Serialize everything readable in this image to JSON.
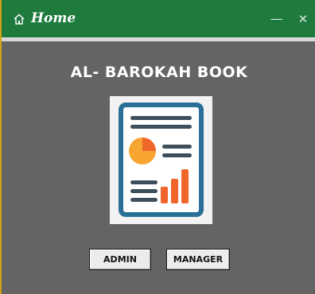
{
  "window": {
    "title": "Home",
    "minimize_symbol": "—",
    "close_symbol": "✕",
    "title_icon": "home-icon"
  },
  "main": {
    "app_title": "AL- BAROKAH BOOK",
    "image_icon": "report-document-icon"
  },
  "buttons": {
    "admin_label": "ADMIN",
    "manager_label": "MANAGER"
  },
  "colors": {
    "titlebar": "#1e7b3d",
    "background": "#646464",
    "accent_blue": "#2a6f97",
    "accent_orange": "#f0652a",
    "accent_yellow": "#f6a531"
  }
}
